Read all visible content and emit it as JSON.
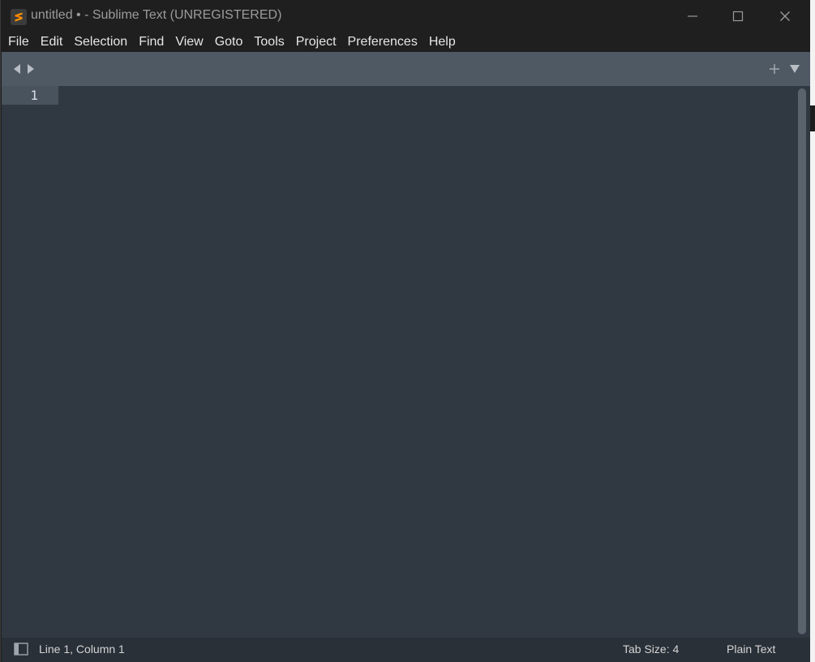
{
  "window": {
    "title": "untitled • - Sublime Text (UNREGISTERED)",
    "app_icon": "sublime-logo-icon",
    "controls": [
      "minimize-icon",
      "maximize-icon",
      "close-icon"
    ]
  },
  "menu": {
    "items": [
      {
        "label": "File"
      },
      {
        "label": "Edit"
      },
      {
        "label": "Selection"
      },
      {
        "label": "Find"
      },
      {
        "label": "View"
      },
      {
        "label": "Goto"
      },
      {
        "label": "Tools"
      },
      {
        "label": "Project"
      },
      {
        "label": "Preferences"
      },
      {
        "label": "Help"
      }
    ]
  },
  "tabbar": {
    "left_icons": [
      "arrow-left-icon",
      "arrow-right-icon"
    ],
    "right_icons": [
      "plus-icon",
      "dropdown-icon"
    ]
  },
  "editor": {
    "line_numbers": [
      "1"
    ],
    "content": ""
  },
  "status": {
    "panel_icon": "panel-toggle-icon",
    "position": "Line 1, Column 1",
    "tab_size": "Tab Size: 4",
    "syntax": "Plain Text"
  },
  "colors": {
    "editor_bg": "#303841",
    "tabbar_bg": "#4e5964",
    "titlebar_bg": "#1f1f1f",
    "accent": "#f39c12"
  }
}
